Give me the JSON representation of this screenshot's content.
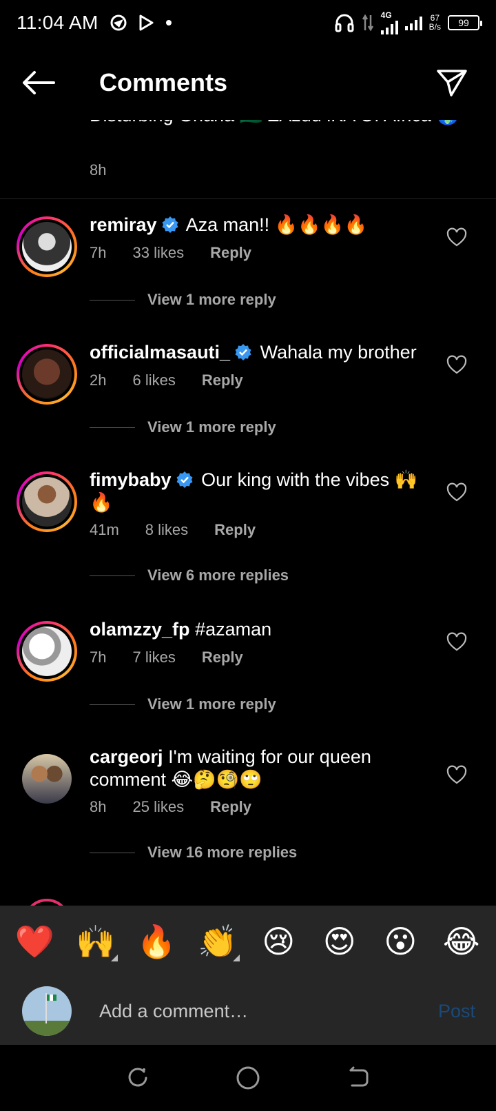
{
  "status": {
    "time": "11:04 AM",
    "network": "4G",
    "speed_value": "67",
    "speed_unit": "B/s",
    "battery": "99"
  },
  "header": {
    "title": "Comments",
    "back_icon": "arrow-left-icon",
    "send_icon": "paper-plane-icon"
  },
  "caption": {
    "text": "Disturbing Ghana 🇬🇭 ZAzuu lKA Of Africa 🌍",
    "time": "8h"
  },
  "comments": [
    {
      "username": "remiray",
      "verified": true,
      "text": "Aza man!! 🔥🔥🔥🔥",
      "time": "7h",
      "likes": "33 likes",
      "reply_label": "Reply",
      "view_replies": "View 1 more reply"
    },
    {
      "username": "officialmasauti_",
      "verified": true,
      "text": "Wahala my brother",
      "time": "2h",
      "likes": "6 likes",
      "reply_label": "Reply",
      "view_replies": "View 1 more reply"
    },
    {
      "username": "fimybaby",
      "verified": true,
      "text": "Our king with the vibes 🙌 🔥",
      "time": "41m",
      "likes": "8 likes",
      "reply_label": "Reply",
      "view_replies": "View 6 more replies"
    },
    {
      "username": "olamzzy_fp",
      "verified": false,
      "text": "#azaman",
      "time": "7h",
      "likes": "7 likes",
      "reply_label": "Reply",
      "view_replies": "View 1 more reply"
    },
    {
      "username": "cargeorj",
      "verified": false,
      "text": "I'm waiting for our queen comment 😂🤔🧐🙄",
      "time": "8h",
      "likes": "25 likes",
      "reply_label": "Reply",
      "view_replies": "View 16 more replies"
    }
  ],
  "emoji_bar": [
    "❤️",
    "🙌",
    "🔥",
    "👏",
    "😢",
    "😍",
    "😮",
    "😂"
  ],
  "composer": {
    "placeholder": "Add a comment…",
    "post_label": "Post"
  },
  "colors": {
    "background": "#000000",
    "secondary_text": "#a8a8a8",
    "verified_blue": "#3897f0",
    "post_disabled": "#1a4a7a",
    "bar_bg": "#262626"
  }
}
